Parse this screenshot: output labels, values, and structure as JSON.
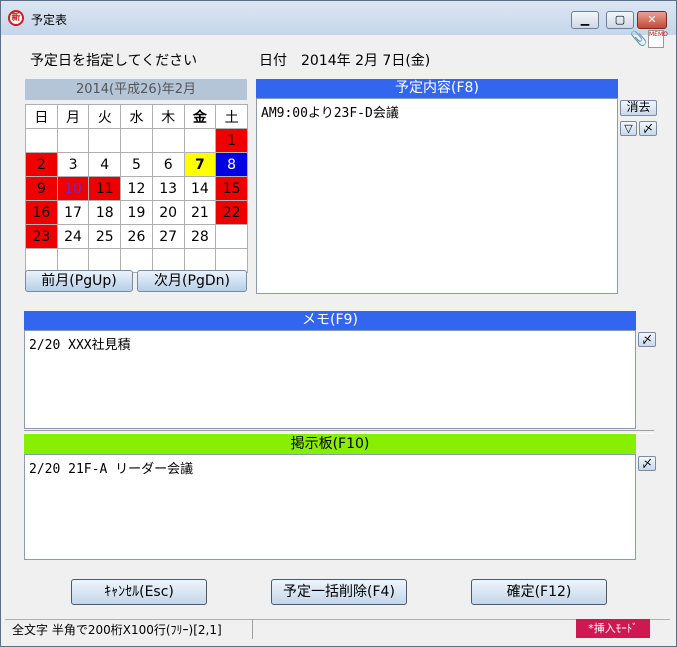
{
  "window": {
    "title": "予定表",
    "app_icon_glyph": "新"
  },
  "header": {
    "prompt": "予定日を指定してください",
    "date_label": "日付　2014年 2月 7日(金)"
  },
  "calendar": {
    "month_title": "2014(平成26)年2月",
    "weekdays": [
      "日",
      "月",
      "火",
      "水",
      "木",
      "金",
      "土"
    ],
    "weeks": [
      [
        "",
        "",
        "",
        "",
        "",
        "",
        "1"
      ],
      [
        "2",
        "3",
        "4",
        "5",
        "6",
        "7",
        "8"
      ],
      [
        "9",
        "10",
        "11",
        "12",
        "13",
        "14",
        "15"
      ],
      [
        "16",
        "17",
        "18",
        "19",
        "20",
        "21",
        "22"
      ],
      [
        "23",
        "24",
        "25",
        "26",
        "27",
        "28",
        ""
      ],
      [
        "",
        "",
        "",
        "",
        "",
        "",
        ""
      ]
    ],
    "prev_label": "前月(PgUp)",
    "next_label": "次月(PgDn)",
    "colors": {
      "holiday": "#ee0000",
      "selected": "#ffff00",
      "saturday_blue": "#0000e0"
    }
  },
  "schedule": {
    "header": "予定内容(F8)",
    "content": "AM9:00より23F-D会議",
    "delete_label": "消去",
    "down_glyph": "▽",
    "mail_glyph": "〆"
  },
  "memo": {
    "header": "メモ(F9)",
    "content": "2/20 XXX社見積",
    "mail_glyph": "〆"
  },
  "board": {
    "header": "掲示板(F10)",
    "content": "2/20 21F-A リーダー会議",
    "mail_glyph": "〆",
    "header_color": "#88ee00"
  },
  "buttons": {
    "cancel": "ｷｬﾝｾﾙ(Esc)",
    "delete_all": "予定一括削除(F4)",
    "confirm": "確定(F12)"
  },
  "status": {
    "text": "全文字 半角で200桁X100行(ﾌﾘｰ)[2,1]",
    "mode": "*挿入ﾓｰﾄﾞ"
  },
  "icons": {
    "clip": "paperclip-icon",
    "note": "note-icon"
  }
}
